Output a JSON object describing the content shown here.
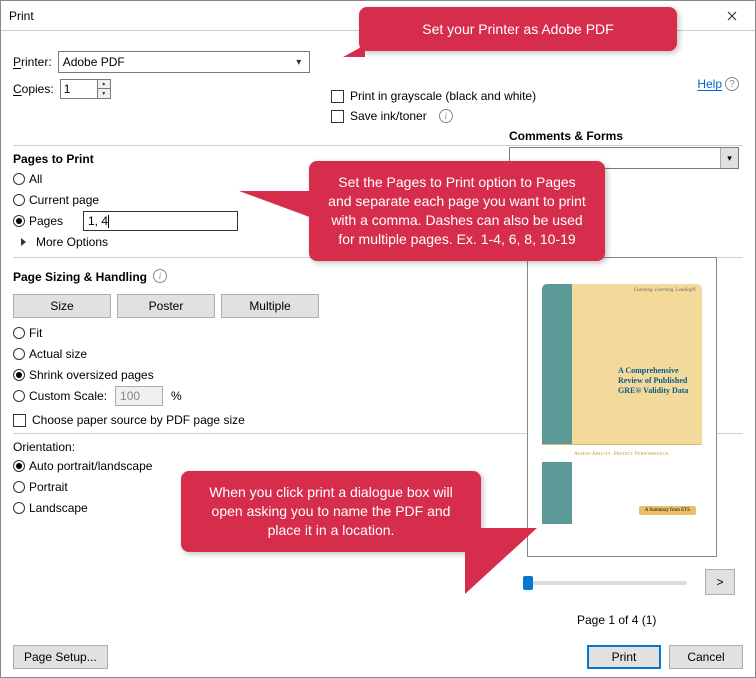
{
  "window": {
    "title": "Print"
  },
  "help": {
    "text": "Help"
  },
  "printer": {
    "label_u": "P",
    "label_rest": "rinter:",
    "value": "Adobe PDF"
  },
  "copies": {
    "label_u": "C",
    "label_rest": "opies:",
    "value": "1"
  },
  "grayscale": {
    "label": "Print in grayscale (black and white)"
  },
  "saveink": {
    "label": "Save ink/toner"
  },
  "pages_to_print": {
    "title": "Pages to Print",
    "all": "All",
    "current": "Current page",
    "pages": "Pages",
    "pages_value": "1, 4",
    "more": "More Options"
  },
  "sizing": {
    "title": "Page Sizing & Handling",
    "size": "Size",
    "poster": "Poster",
    "multiple": "Multiple",
    "fit": "Fit",
    "actual": "Actual size",
    "shrink": "Shrink oversized pages",
    "custom": "Custom Scale:",
    "scale_value": "100",
    "percent": "%",
    "choose_source": "Choose paper source by PDF page size"
  },
  "orientation": {
    "title": "Orientation:",
    "auto": "Auto portrait/landscape",
    "portrait": "Portrait",
    "landscape": "Landscape"
  },
  "comments": {
    "title": "Comments & Forms"
  },
  "preview": {
    "small": "Listening. Learning. Leading®",
    "doc_title": "A Comprehensive Review of Published GRE® Validity Data",
    "tagline": "Assess Ability. Predict Performance.",
    "summary": "A Summary from ETS",
    "next": ">",
    "page_indicator": "Page 1 of 4 (1)"
  },
  "footer": {
    "page_setup": "Page Setup...",
    "print": "Print",
    "cancel": "Cancel"
  },
  "callouts": {
    "c1": "Set your Printer as Adobe PDF",
    "c2": "Set the Pages to Print option to Pages and separate each page you want to print with a comma. Dashes can also be used for multiple pages. Ex. 1-4, 6, 8, 10-19",
    "c3": "When you click print a dialogue box will open asking you to name the PDF and place it in a location."
  }
}
